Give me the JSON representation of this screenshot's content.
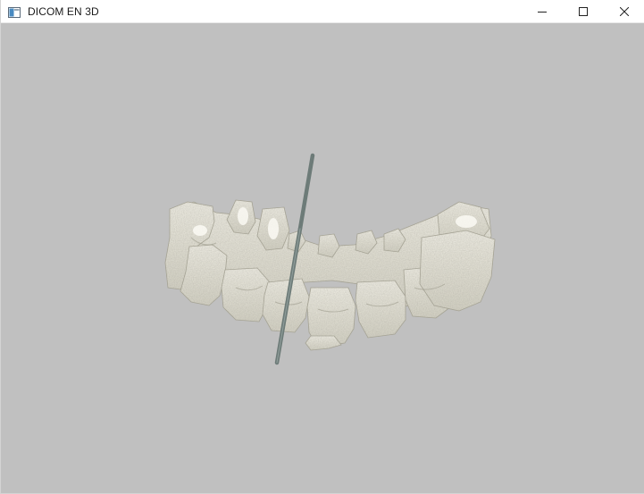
{
  "window": {
    "title": "DICOM EN 3D"
  },
  "titlebar": {
    "icon": "app-window-icon",
    "controls": [
      "minimize-icon",
      "maximize-icon",
      "close-icon"
    ]
  },
  "viewport": {
    "background": "#c0c0c0",
    "model": {
      "description_icon": "spine-3d-model",
      "bone_color": "#e8e6da",
      "bone_shade": "#b9b7a8",
      "rod_color": "#6d7b78"
    }
  }
}
